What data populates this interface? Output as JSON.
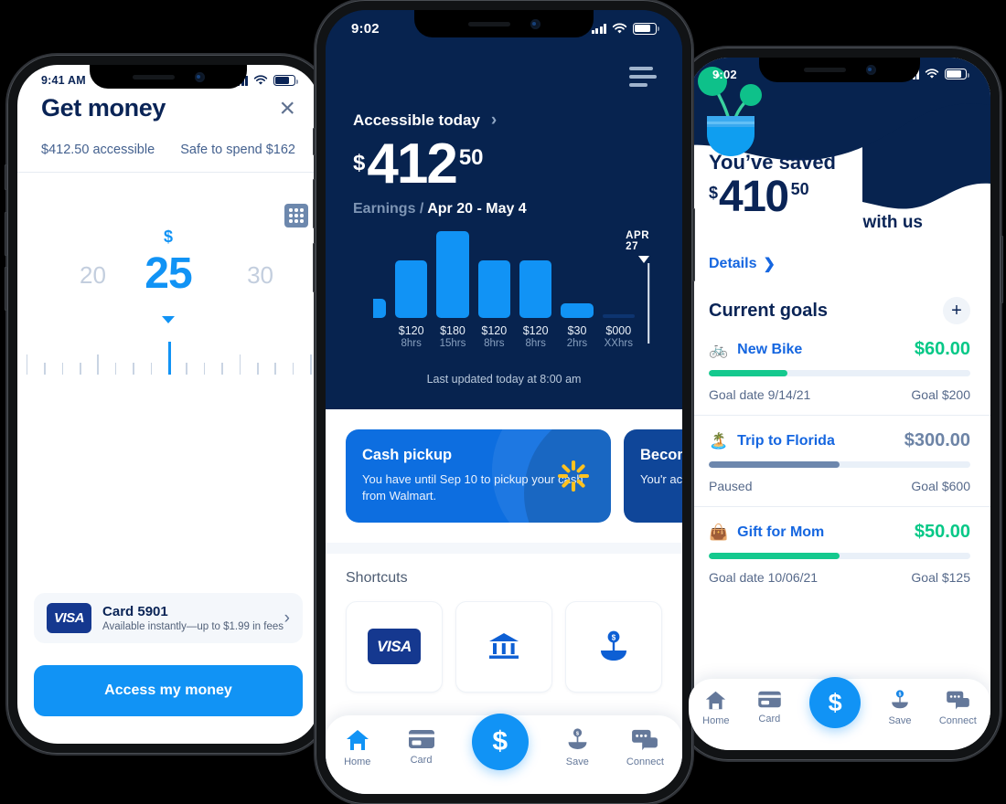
{
  "phone1": {
    "status": {
      "time": "9:41 AM"
    },
    "title": "Get money",
    "close_icon": "×",
    "accessible_label": "$412.50 accessible",
    "safe_to_spend_label": "Safe to spend $162",
    "keypad_icon": "keypad-icon",
    "dial": {
      "currency": "$",
      "value": "25",
      "left_tick_label": "20",
      "right_tick_label": "30"
    },
    "card": {
      "brand": "VISA",
      "title": "Card 5901",
      "subtitle": "Available instantly—up to $1.99 in fees",
      "chevron": "›"
    },
    "cta_label": "Access my money"
  },
  "phone2": {
    "status": {
      "time": "9:02"
    },
    "menu_icon": "hamburger-icon",
    "accessible_today_label": "Accessible today",
    "accessible_chevron": "›",
    "amount": {
      "currency": "$",
      "integer": "412",
      "cents": "50"
    },
    "earnings_label": "Earnings /",
    "earnings_range": "Apr 20 - May 4",
    "marker_label": "APR 27",
    "last_updated": "Last updated today at 8:00 am",
    "promos": [
      {
        "title": "Cash pickup",
        "body": "You have until Sep 10 to pickup your cash from Walmart.",
        "icon": "walmart-spark-icon",
        "style": "blue"
      },
      {
        "title": "Become",
        "body": "You'r achie",
        "style": "navy"
      }
    ],
    "shortcuts_label": "Shortcuts",
    "shortcuts": [
      {
        "icon": "visa-card-icon",
        "label": "VISA"
      },
      {
        "icon": "bank-icon",
        "label": ""
      },
      {
        "icon": "save-plant-icon",
        "label": ""
      }
    ],
    "nav": [
      {
        "icon": "home-icon",
        "label": "Home"
      },
      {
        "icon": "card-icon",
        "label": "Card"
      },
      {
        "icon": "dollar-fab-icon",
        "label": "$"
      },
      {
        "icon": "save-icon",
        "label": "Save"
      },
      {
        "icon": "connect-icon",
        "label": "Connect"
      }
    ],
    "chart_data": {
      "type": "bar",
      "title": "Earnings / Apr 20 - May 4",
      "categories": [
        "",
        "",
        "",
        "",
        "",
        "",
        ""
      ],
      "values": [
        40,
        120,
        180,
        120,
        120,
        30,
        0
      ],
      "value_labels": [
        "",
        "$120",
        "$180",
        "$120",
        "$120",
        "$30",
        "$000"
      ],
      "hour_labels": [
        "",
        "8hrs",
        "15hrs",
        "8hrs",
        "8hrs",
        "2hrs",
        "XXhrs"
      ],
      "annotation": "APR 27",
      "annotation_index": 5,
      "xlabel": "",
      "ylabel": "",
      "ylim": [
        0,
        190
      ],
      "grid": false,
      "bar_color": "#1193f5",
      "empty_bar_color": "#0d3470",
      "legend": "none"
    }
  },
  "phone3": {
    "status": {
      "time": "9:02"
    },
    "saved_label": "You’ve saved",
    "amount": {
      "currency": "$",
      "integer": "410",
      "cents": "50"
    },
    "with_us_label": "with us",
    "details_label": "Details",
    "details_chevron": "❯",
    "plant_icon": "plant-pot-icon",
    "goals_title": "Current goals",
    "add_goal_icon": "+",
    "goals": [
      {
        "emoji": "🚲",
        "icon_name": "bicycle-icon",
        "name": "New Bike",
        "amount": "$60.00",
        "amount_color": "green",
        "progress": 30,
        "bar_color": "#14c98e",
        "footer_left": "Goal date 9/14/21",
        "footer_right": "Goal $200"
      },
      {
        "emoji": "🏝️",
        "icon_name": "palm-island-icon",
        "name": "Trip to Florida",
        "amount": "$300.00",
        "amount_color": "grey",
        "progress": 50,
        "bar_color": "#6d87ad",
        "footer_left": "Paused",
        "footer_right": "Goal $600"
      },
      {
        "emoji": "👜",
        "icon_name": "handbag-icon",
        "name": "Gift for Mom",
        "amount": "$50.00",
        "amount_color": "green",
        "progress": 50,
        "bar_color": "#14c98e",
        "footer_left": "Goal date 10/06/21",
        "footer_right": "Goal $125"
      }
    ],
    "nav": [
      {
        "icon": "home-icon",
        "label": "Home"
      },
      {
        "icon": "card-icon",
        "label": "Card"
      },
      {
        "icon": "dollar-fab-icon",
        "label": "$"
      },
      {
        "icon": "save-icon",
        "label": "Save"
      },
      {
        "icon": "connect-icon",
        "label": "Connect"
      }
    ]
  },
  "colors": {
    "accent_blue": "#1193f5",
    "navy": "#07234f",
    "green": "#07c887",
    "link_blue": "#1566e0"
  }
}
